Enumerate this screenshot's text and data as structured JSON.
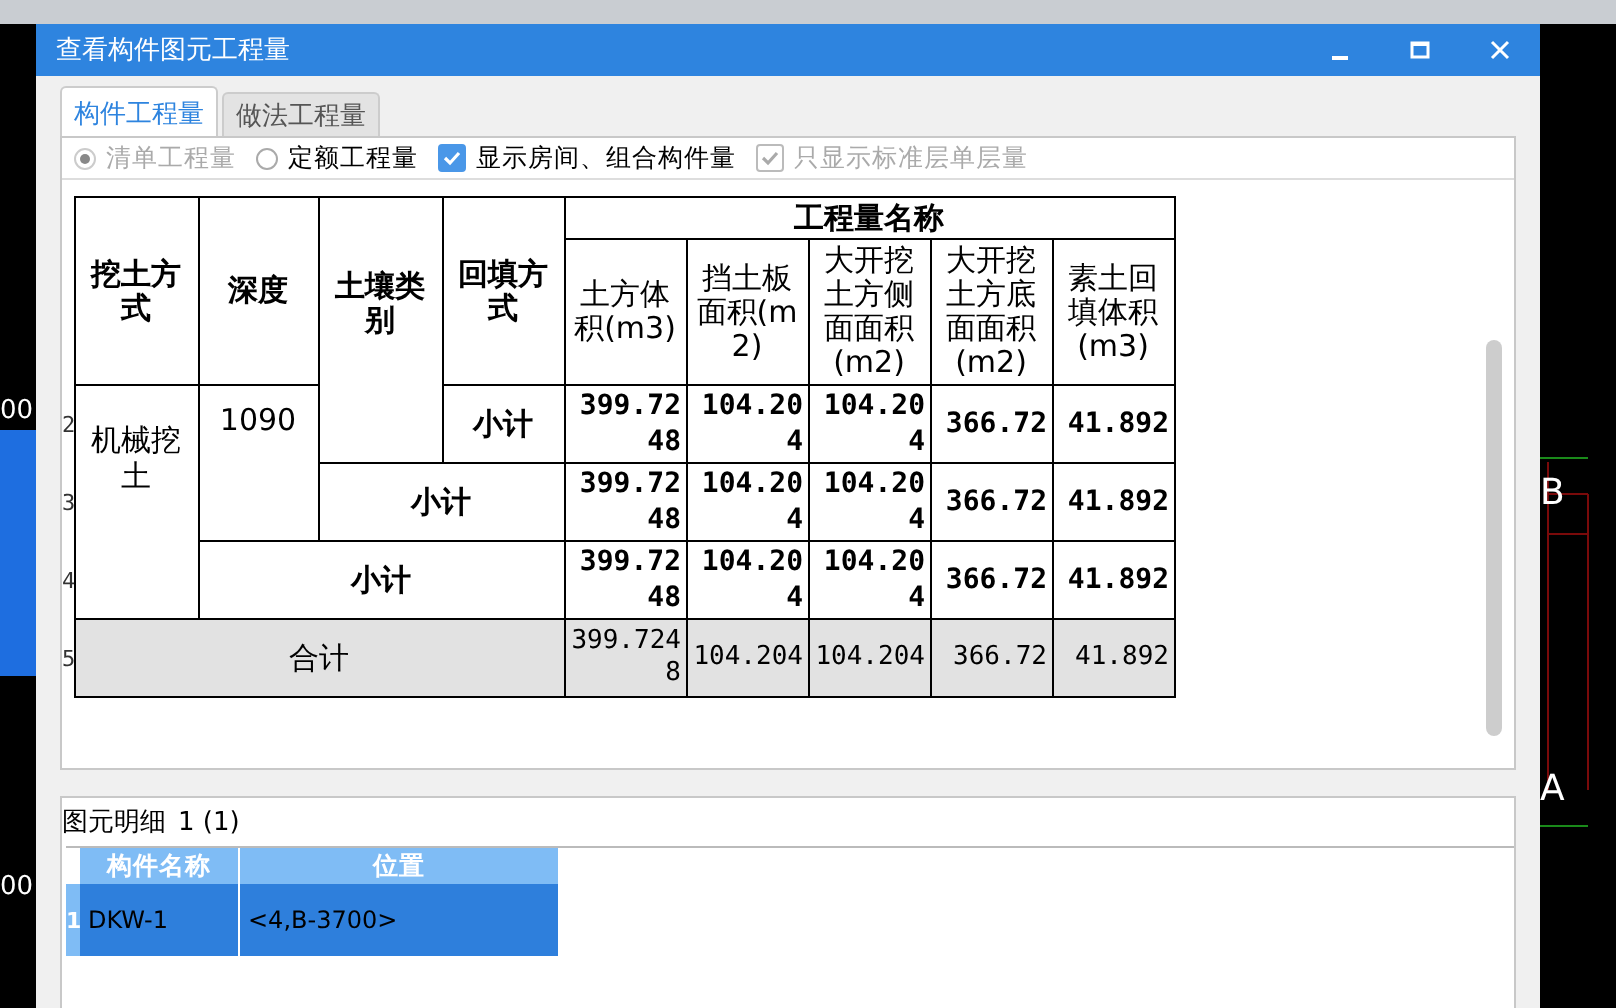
{
  "cad_background": {
    "left_labels": [
      "00",
      "00"
    ],
    "axis_labels": [
      "B",
      "A"
    ]
  },
  "window": {
    "title": "查看构件图元工程量"
  },
  "tabs": [
    {
      "label": "构件工程量",
      "selected": true
    },
    {
      "label": "做法工程量",
      "selected": false
    }
  ],
  "options": [
    {
      "kind": "radio",
      "label": "清单工程量",
      "selected": true,
      "disabled": true
    },
    {
      "kind": "radio",
      "label": "定额工程量",
      "selected": false,
      "disabled": false
    },
    {
      "kind": "checkbox",
      "label": "显示房间、组合构件量",
      "checked": true,
      "disabled": false
    },
    {
      "kind": "checkbox",
      "label": "只显示标准层单层量",
      "checked": true,
      "disabled": true
    }
  ],
  "quantity_table": {
    "group_header": "工程量名称",
    "key_columns": [
      "挖土方式",
      "深度",
      "土壤类别",
      "回填方式"
    ],
    "value_columns": [
      "土方体积(m3)",
      "挡土板面积(m2)",
      "大开挖土方侧面面积(m2)",
      "大开挖土方底面面积(m2)",
      "素土回填体积(m3)"
    ],
    "rows": [
      {
        "row_number": "2",
        "kind": "detail",
        "excavation": "机械挖土",
        "depth": "1090",
        "label": "小计",
        "values": [
          "399.7248",
          "104.204",
          "104.204",
          "366.72",
          "41.892"
        ]
      },
      {
        "row_number": "3",
        "kind": "soil_subtotal",
        "label": "小计",
        "values": [
          "399.7248",
          "104.204",
          "104.204",
          "366.72",
          "41.892"
        ]
      },
      {
        "row_number": "4",
        "kind": "depth_subtotal",
        "label": "小计",
        "values": [
          "399.7248",
          "104.204",
          "104.204",
          "366.72",
          "41.892"
        ]
      },
      {
        "row_number": "5",
        "kind": "total",
        "label": "合计",
        "values": [
          "399.7248",
          "104.204",
          "104.204",
          "366.72",
          "41.892"
        ]
      }
    ]
  },
  "detail": {
    "title": "图元明细",
    "count": "1 (1)",
    "columns": [
      "构件名称",
      "位置"
    ],
    "rows": [
      {
        "row_number": "1",
        "selected": true,
        "cells": [
          "DKW-1",
          "<4,B-3700>"
        ]
      }
    ]
  }
}
